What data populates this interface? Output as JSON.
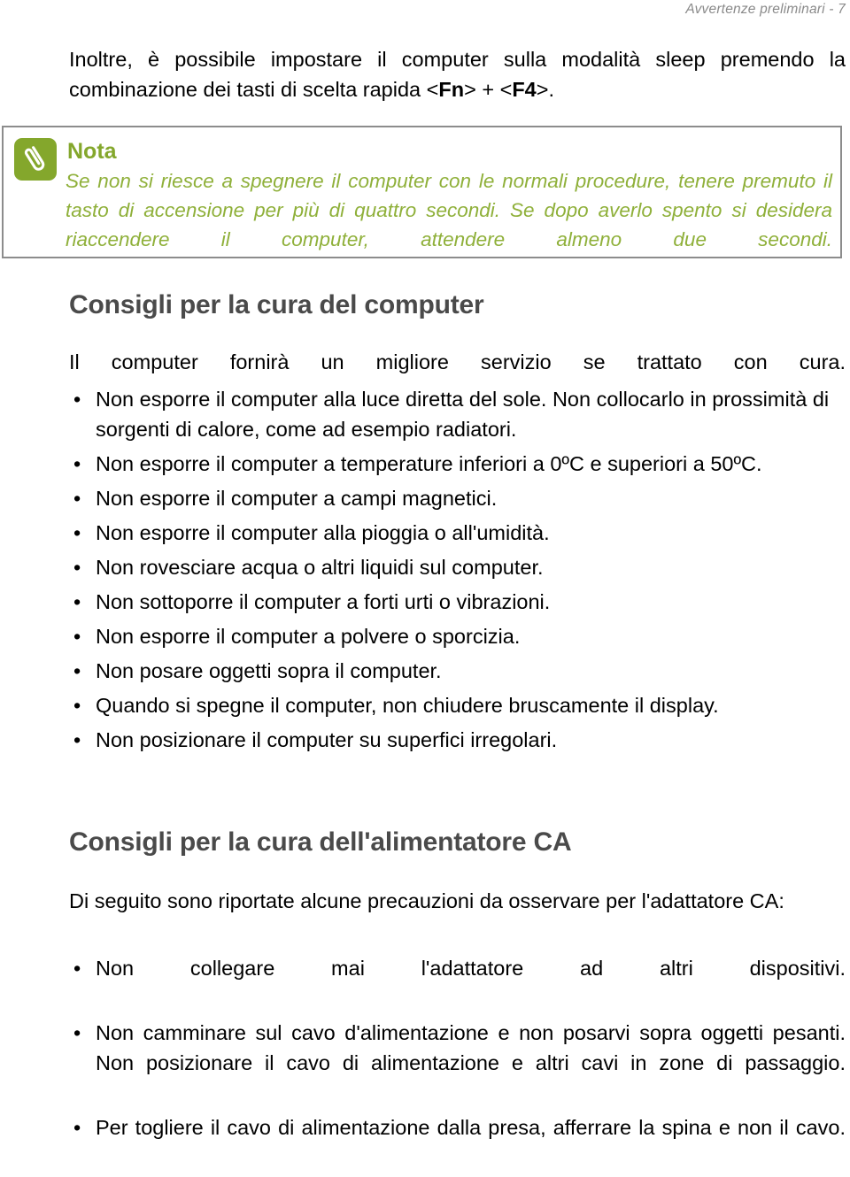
{
  "header": {
    "running_title": "Avvertenze preliminari - 7"
  },
  "intro": {
    "text_before": "Inoltre, è possibile impostare il computer sulla modalità sleep premendo la combinazione dei tasti di scelta rapida <",
    "key1": "Fn",
    "text_between": "> + <",
    "key2": "F4",
    "text_after": ">."
  },
  "note": {
    "icon": "paperclip-icon",
    "title": "Nota",
    "body": "Se non si riesce a spegnere il computer con le normali procedure, tenere premuto il tasto di accensione per più di quattro secondi. Se dopo averlo spento si desidera riaccendere il computer, attendere almeno due secondi.",
    "accent_color": "#84a72c",
    "text_color": "#8fb03a",
    "border_color": "#8c8c8c"
  },
  "section_computer": {
    "heading": "Consigli per la cura del computer",
    "intro": "Il computer fornirà un migliore servizio se trattato con cura.",
    "bullet_marker": "•",
    "bullets": [
      "Non esporre il computer alla luce diretta del sole. Non collocarlo in prossimità di sorgenti di calore, come ad esempio radiatori.",
      "Non esporre il computer a temperature inferiori a 0ºC e superiori a 50ºC.",
      "Non esporre il computer a campi magnetici.",
      "Non esporre il computer alla pioggia o all'umidità.",
      "Non rovesciare acqua o altri liquidi sul computer.",
      "Non sottoporre il computer a forti urti o vibrazioni.",
      "Non esporre il computer a polvere o sporcizia.",
      "Non posare oggetti sopra il computer.",
      "Quando si spegne il computer, non chiudere bruscamente il display.",
      "Non posizionare il computer su superfici irregolari."
    ]
  },
  "section_adapter": {
    "heading": "Consigli per la cura dell'alimentatore CA",
    "intro": "Di seguito sono riportate alcune precauzioni da osservare per l'adattatore CA:",
    "bullet_marker": "•",
    "bullets": [
      "Non collegare mai l'adattatore ad altri dispositivi.",
      "Non camminare sul cavo d'alimentazione e non posarvi sopra oggetti pesanti. Non posizionare il cavo di alimentazione e altri cavi in zone di passaggio.",
      "Per togliere il cavo di alimentazione dalla presa, afferrare la spina e non il cavo."
    ]
  },
  "colors": {
    "heading_gray": "#4a4a4a",
    "header_gray": "#8a8a8a",
    "body_black": "#000000"
  }
}
